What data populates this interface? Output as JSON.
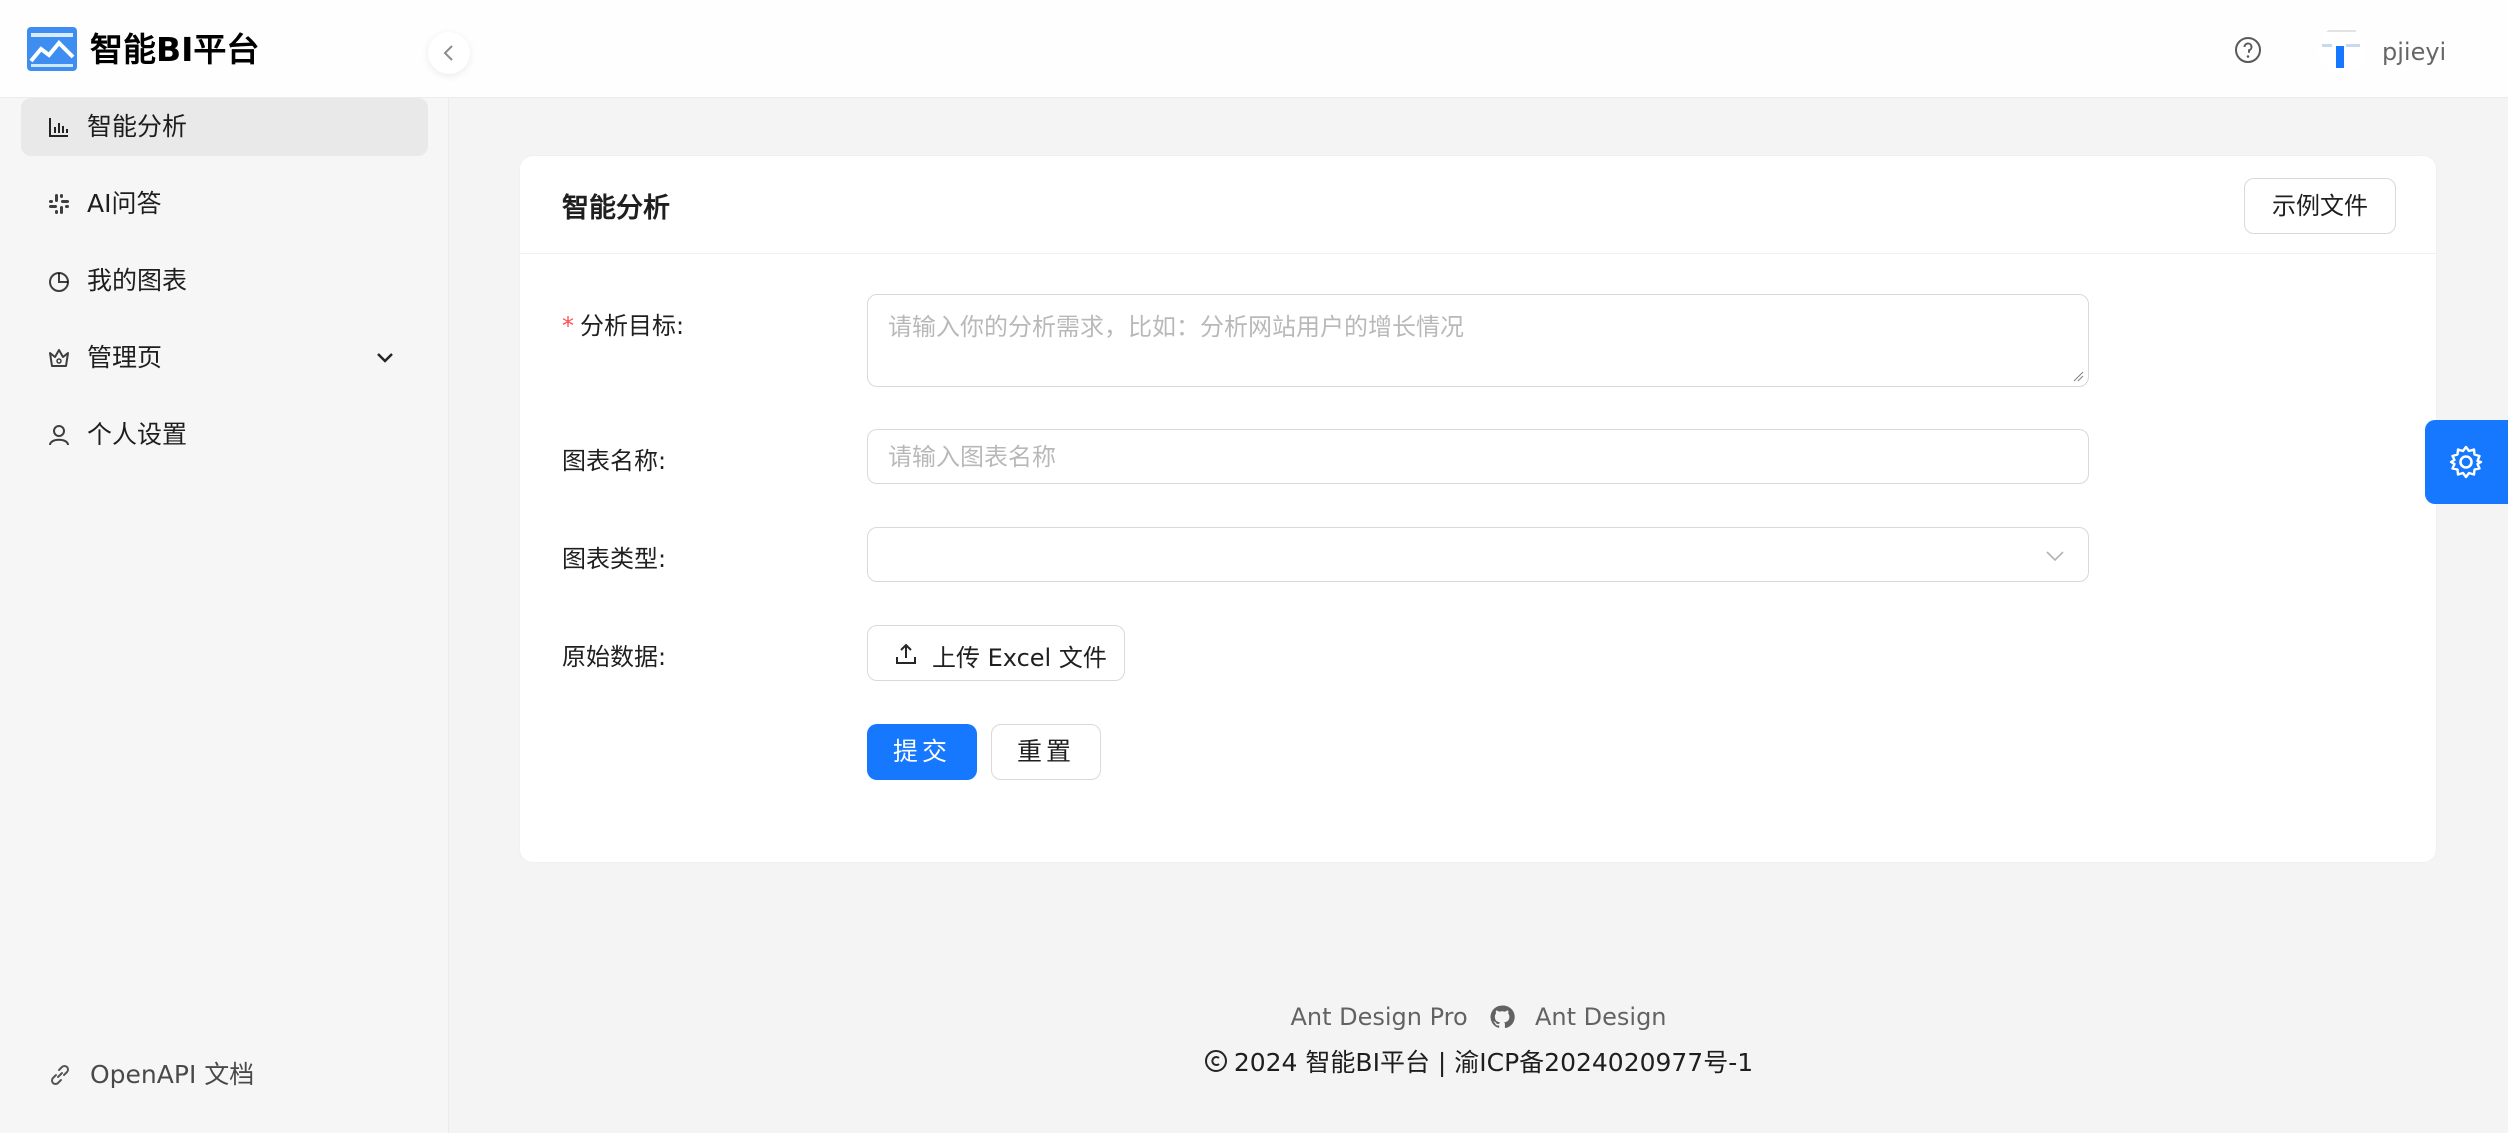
{
  "app": {
    "title": "智能BI平台"
  },
  "header": {
    "username": "pjieyi"
  },
  "sidebar": {
    "items": [
      {
        "label": "智能分析",
        "icon": "bar-chart-icon",
        "active": true
      },
      {
        "label": "AI问答",
        "icon": "slack-icon"
      },
      {
        "label": "我的图表",
        "icon": "pie-chart-icon"
      },
      {
        "label": "管理页",
        "icon": "crown-icon",
        "expandable": true
      },
      {
        "label": "个人设置",
        "icon": "user-icon"
      }
    ],
    "openapi_label": "OpenAPI 文档"
  },
  "card": {
    "title": "智能分析",
    "example_button": "示例文件"
  },
  "form": {
    "goal_label": "分析目标:",
    "goal_placeholder": "请输入你的分析需求，比如：分析网站用户的增长情况",
    "name_label": "图表名称:",
    "name_placeholder": "请输入图表名称",
    "type_label": "图表类型:",
    "type_value": "",
    "data_label": "原始数据:",
    "upload_label": "上传 Excel 文件",
    "submit_label": "提交",
    "reset_label": "重置"
  },
  "footer": {
    "link1": "Ant Design Pro",
    "link2": "Ant Design",
    "copyright": "2024 智能BI平台 | 渝ICP备2024020977号-1"
  },
  "colors": {
    "primary": "#1677ff",
    "required": "#ff4d4f"
  }
}
